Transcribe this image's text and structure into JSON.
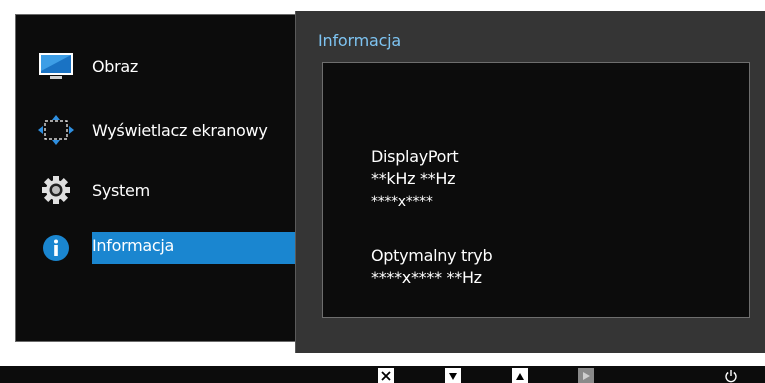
{
  "menu": {
    "items": [
      {
        "label": "Obraz",
        "icon": "monitor-icon"
      },
      {
        "label": "Wyświetlacz ekranowy",
        "icon": "osd-arrows-icon"
      },
      {
        "label": "System",
        "icon": "gear-icon"
      },
      {
        "label": "Informacja",
        "icon": "info-icon",
        "selected": true
      }
    ]
  },
  "info": {
    "title": "Informacja",
    "source": "DisplayPort",
    "frequency": "**kHz **Hz",
    "resolution": "****x****",
    "optimal_label": "Optymalny tryb",
    "optimal_value": "****x**** **Hz"
  },
  "bottom_bar": {
    "buttons": [
      "close-icon",
      "down-arrow-icon",
      "up-arrow-icon",
      "play-icon",
      "power-icon"
    ]
  },
  "colors": {
    "accent": "#1a86d0",
    "title": "#7ec4f2",
    "panel": "#353535",
    "background": "#0c0c0c"
  }
}
